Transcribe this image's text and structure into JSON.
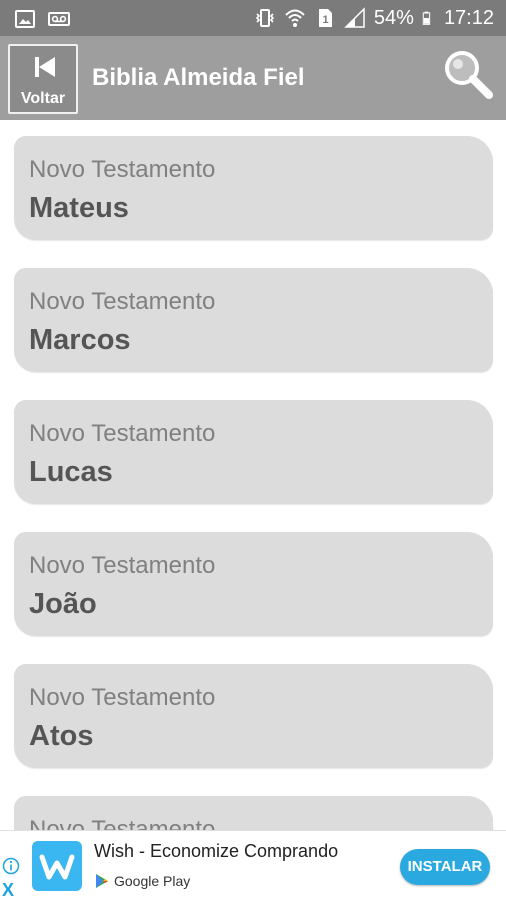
{
  "status_bar": {
    "battery_text": "54%",
    "time": "17:12",
    "left_icons": [
      "image-icon",
      "voicemail-icon"
    ],
    "right_icons": [
      "vibrate-icon",
      "wifi-icon",
      "sim1-icon",
      "signal-icon",
      "battery-icon"
    ]
  },
  "toolbar": {
    "back_label": "Voltar",
    "title": "Biblia Almeida Fiel",
    "search_icon": "search-icon"
  },
  "books": [
    {
      "testament": "Novo Testamento",
      "name": "Mateus"
    },
    {
      "testament": "Novo Testamento",
      "name": "Marcos"
    },
    {
      "testament": "Novo Testamento",
      "name": "Lucas"
    },
    {
      "testament": "Novo Testamento",
      "name": "João"
    },
    {
      "testament": "Novo Testamento",
      "name": "Atos"
    },
    {
      "testament": "Novo Testamento",
      "name": ""
    }
  ],
  "ad": {
    "title": "Wish - Economize Comprando",
    "store": "Google Play",
    "button": "INSTALAR",
    "close_glyph": "X"
  },
  "colors": {
    "status_bar": "#7b7b7b",
    "toolbar": "#9e9e9e",
    "card": "#dcdcdc",
    "ad_accent": "#2aa9e0"
  }
}
